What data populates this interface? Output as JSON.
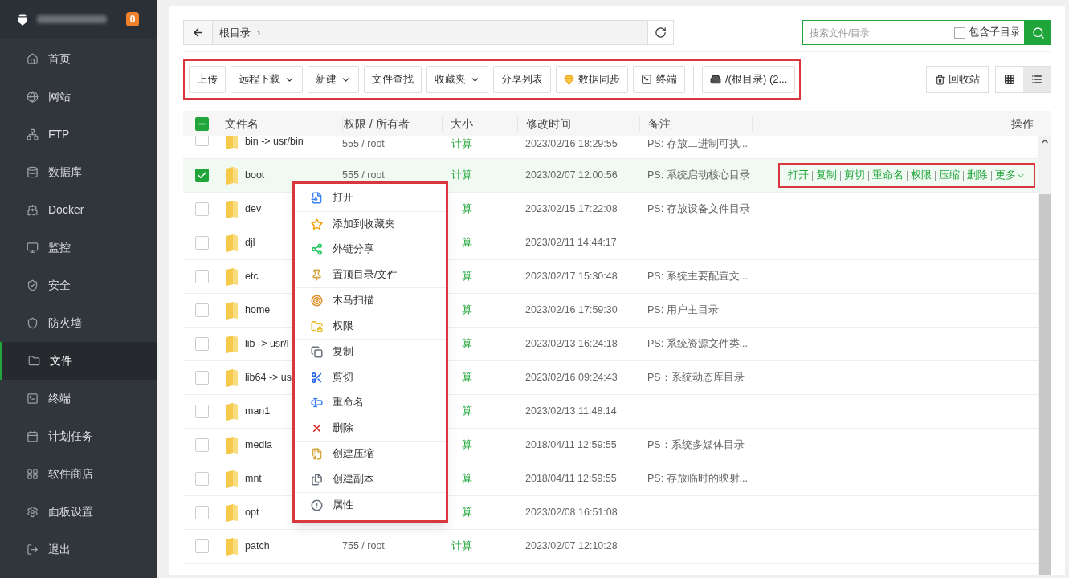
{
  "sidebar": {
    "badge": "0",
    "items": [
      {
        "label": "首页",
        "selected": false
      },
      {
        "label": "网站",
        "selected": false
      },
      {
        "label": "FTP",
        "selected": false
      },
      {
        "label": "数据库",
        "selected": false
      },
      {
        "label": "Docker",
        "selected": false
      },
      {
        "label": "监控",
        "selected": false
      },
      {
        "label": "安全",
        "selected": false
      },
      {
        "label": "防火墙",
        "selected": false
      },
      {
        "label": "文件",
        "selected": true
      },
      {
        "label": "终端",
        "selected": false
      },
      {
        "label": "计划任务",
        "selected": false
      },
      {
        "label": "软件商店",
        "selected": false
      },
      {
        "label": "面板设置",
        "selected": false
      },
      {
        "label": "退出",
        "selected": false
      }
    ]
  },
  "breadcrumb": {
    "path": "根目录",
    "separator": "›"
  },
  "search": {
    "placeholder": "搜索文件/目录",
    "include_subdirs": {
      "label": "包含子目录",
      "checked": false
    }
  },
  "toolbar": [
    {
      "label": "上传",
      "kind": "plain"
    },
    {
      "label": "远程下载",
      "kind": "dropdown"
    },
    {
      "label": "新建",
      "kind": "dropdown"
    },
    {
      "label": "文件查找",
      "kind": "plain"
    },
    {
      "label": "收藏夹",
      "kind": "dropdown"
    },
    {
      "label": "分享列表",
      "kind": "plain"
    },
    {
      "label": "数据同步",
      "kind": "gem"
    },
    {
      "label": "终端",
      "kind": "terminal"
    },
    {
      "label": "/(根目录) (2...",
      "kind": "disk"
    }
  ],
  "recycle_bin": "回收站",
  "view_modes": [
    {
      "kind": "grid",
      "selected": false
    },
    {
      "kind": "list",
      "selected": true
    }
  ],
  "table": {
    "select_all": {
      "indeterminate": true
    },
    "columns": [
      "文件名",
      "权限 / 所有者",
      "大小",
      "修改时间",
      "备注",
      "操作"
    ],
    "rows": [
      {
        "name": "bin -> usr/bin",
        "perms": "555 / root",
        "size": "计算",
        "mtime": "2023/02/16 18:29:55",
        "note": "PS: 存放二进制可执...",
        "checked": false
      },
      {
        "name": "boot",
        "perms": "555 / root",
        "size": "计算",
        "mtime": "2023/02/07 12:00:56",
        "note": "PS: 系统启动核心目录",
        "checked": true,
        "actions": [
          "打开",
          "复制",
          "剪切",
          "重命名",
          "权限",
          "压缩",
          "删除",
          "更多"
        ]
      },
      {
        "name": "dev",
        "size": "算",
        "mtime": "2023/02/15 17:22:08",
        "note": "PS: 存放设备文件目录",
        "checked": false
      },
      {
        "name": "djl",
        "size": "算",
        "mtime": "2023/02/11 14:44:17",
        "checked": false
      },
      {
        "name": "etc",
        "size": "算",
        "mtime": "2023/02/17 15:30:48",
        "note": "PS: 系统主要配置文...",
        "checked": false
      },
      {
        "name": "home",
        "size": "算",
        "mtime": "2023/02/16 17:59:30",
        "note": "PS: 用户主目录",
        "checked": false
      },
      {
        "name": "lib -> usr/l",
        "size": "算",
        "mtime": "2023/02/13 16:24:18",
        "note": "PS: 系统资源文件类...",
        "checked": false
      },
      {
        "name": "lib64 -> us",
        "size": "算",
        "mtime": "2023/02/16 09:24:43",
        "note": "PS：系统动态库目录",
        "checked": false
      },
      {
        "name": "man1",
        "size": "算",
        "mtime": "2023/02/13 11:48:14",
        "checked": false
      },
      {
        "name": "media",
        "size": "算",
        "mtime": "2018/04/11 12:59:55",
        "note": "PS：系统多媒体目录",
        "checked": false
      },
      {
        "name": "mnt",
        "size": "算",
        "mtime": "2018/04/11 12:59:55",
        "note": "PS: 存放临时的映射...",
        "checked": false
      },
      {
        "name": "opt",
        "size": "算",
        "mtime": "2023/02/08 16:51:08",
        "checked": false
      },
      {
        "name": "patch",
        "perms": "755 / root",
        "size": "计算",
        "mtime": "2023/02/07 12:10:28",
        "checked": false
      }
    ]
  },
  "context_menu": [
    [
      "打开"
    ],
    [
      "添加到收藏夹",
      "外链分享",
      "置顶目录/文件"
    ],
    [
      "木马扫描",
      "权限"
    ],
    [
      "复制",
      "剪切",
      "重命名",
      "删除"
    ],
    [
      "创建压缩",
      "创建副本"
    ],
    [
      "属性"
    ]
  ]
}
